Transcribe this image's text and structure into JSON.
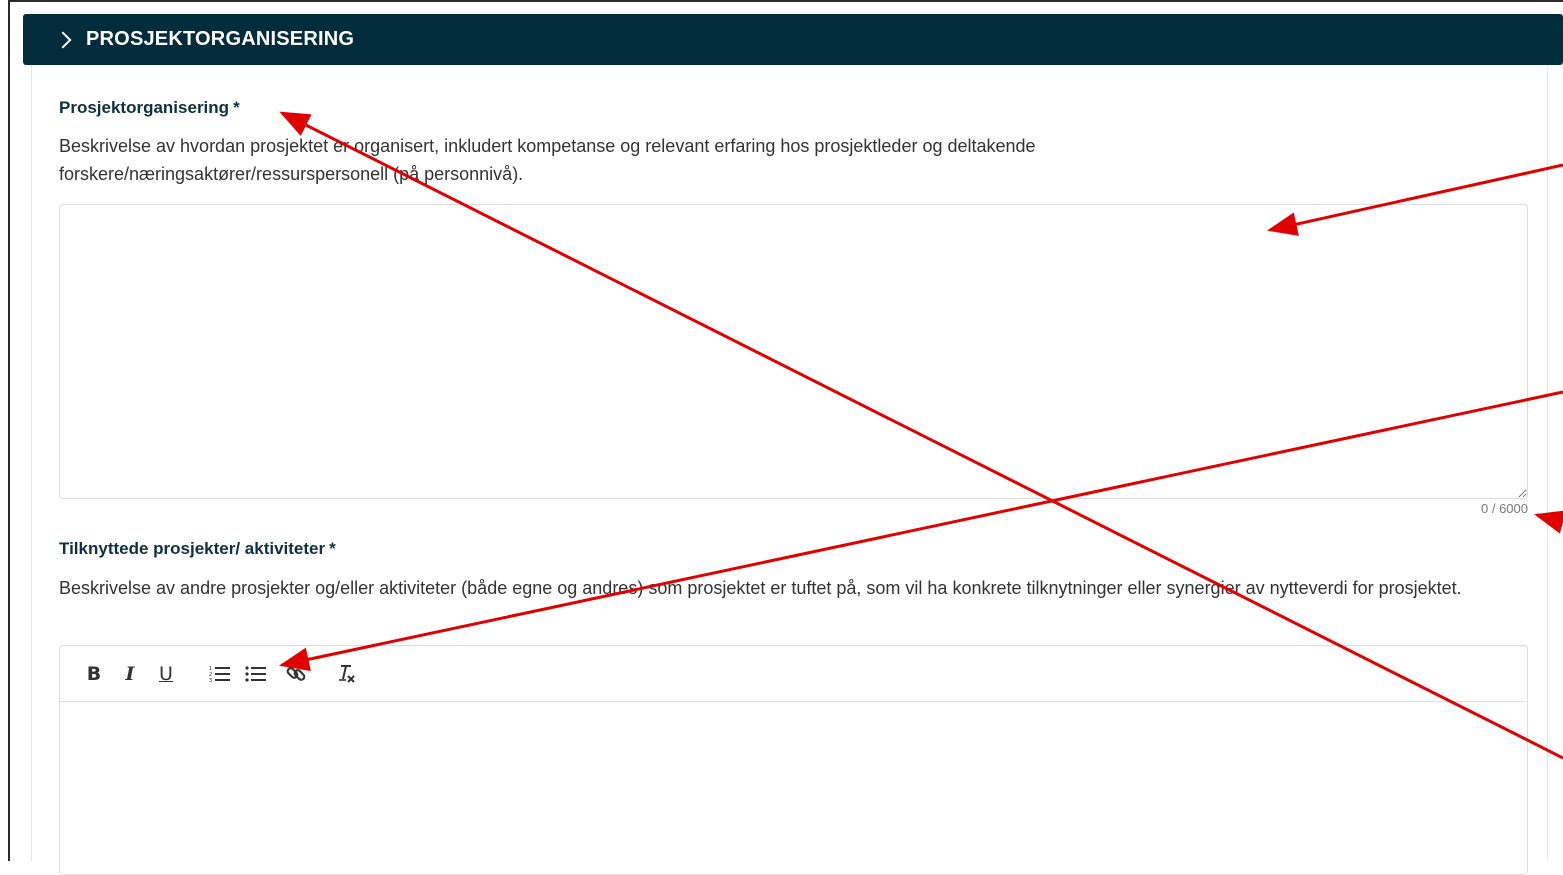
{
  "section": {
    "title": "PROSJEKTORGANISERING"
  },
  "field1": {
    "label": "Prosjektorganisering",
    "required_mark": "*",
    "description": "Beskrivelse av hvordan prosjektet er organisert, inkludert kompetanse og relevant erfaring hos prosjektleder og deltakende forskere/næringsaktører/ressurspersonell (på personnivå).",
    "value": "",
    "counter": "0 / 6000"
  },
  "field2": {
    "label": "Tilknyttede prosjekter/ aktiviteter",
    "required_mark": "*",
    "description": "Beskrivelse av andre prosjekter og/eller aktiviteter (både egne og andres) som prosjektet er tuftet på, som vil ha konkrete tilknytninger eller synergier av nytteverdi for prosjektet.",
    "toolbar": {
      "bold": "B",
      "italic": "I",
      "underline": "U"
    },
    "value": ""
  },
  "icons": {
    "chevron": "chevron-right-icon",
    "ordered_list": "ordered-list-icon",
    "bullet_list": "bullet-list-icon",
    "link": "link-icon",
    "clear_format": "clear-format-icon"
  },
  "colors": {
    "header_bg": "#012c3c",
    "label": "#0d3142",
    "annotation_arrow": "#e00000"
  }
}
